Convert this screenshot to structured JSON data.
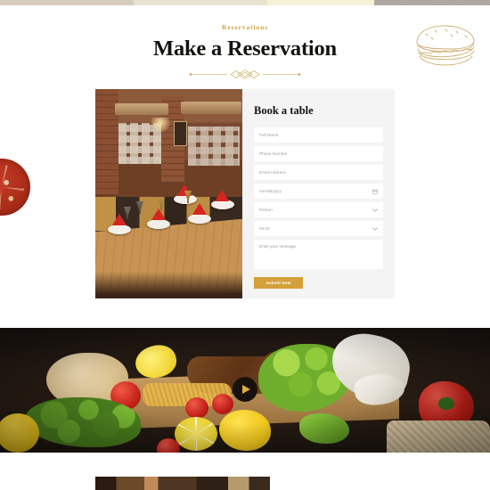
{
  "header": {
    "eyebrow": "Reservations",
    "title": "Make a Reservation",
    "divider_icon": "ornamental-divider",
    "burger_icon": "burger-line-art-icon"
  },
  "decorations": {
    "tomato_icon": "tomato-slice-decoration"
  },
  "reservation": {
    "photo_alt": "restaurant-interior-photo",
    "form": {
      "title": "Book a table",
      "fields": [
        {
          "name": "full-name",
          "placeholder": "Full Name",
          "value": "",
          "type": "text",
          "icon": ""
        },
        {
          "name": "phone-number",
          "placeholder": "Phone Number",
          "value": "",
          "type": "text",
          "icon": ""
        },
        {
          "name": "email-address",
          "placeholder": "Email Address",
          "value": "",
          "type": "email",
          "icon": ""
        },
        {
          "name": "date",
          "placeholder": "mm/dd/yyyy",
          "value": "",
          "type": "date",
          "icon": "calendar-icon"
        },
        {
          "name": "person",
          "placeholder": "Person",
          "value": "Person",
          "type": "select",
          "icon": "chevron-down-icon"
        },
        {
          "name": "time",
          "placeholder": "00:00",
          "value": "00:00",
          "type": "select",
          "icon": "chevron-down-icon"
        }
      ],
      "message": {
        "name": "message",
        "placeholder": "Enter your message",
        "value": ""
      },
      "submit_label": "Submit Now"
    }
  },
  "video_band": {
    "image_alt": "chef-preparing-food-platter",
    "play_icon": "play-icon"
  },
  "bottom_section": {
    "image_alt": "partial-image-below-fold"
  },
  "colors": {
    "accent_gold": "#d4a03a",
    "eyebrow_gold": "#d2a23c",
    "title_dark": "#14120f",
    "panel_bg": "#f4f4f4",
    "field_bg": "#ffffff",
    "placeholder": "#9e9e9e",
    "play_btn_bg": "#17120d",
    "play_tri": "#e2ae3e",
    "page_bg": "#ffffff"
  }
}
